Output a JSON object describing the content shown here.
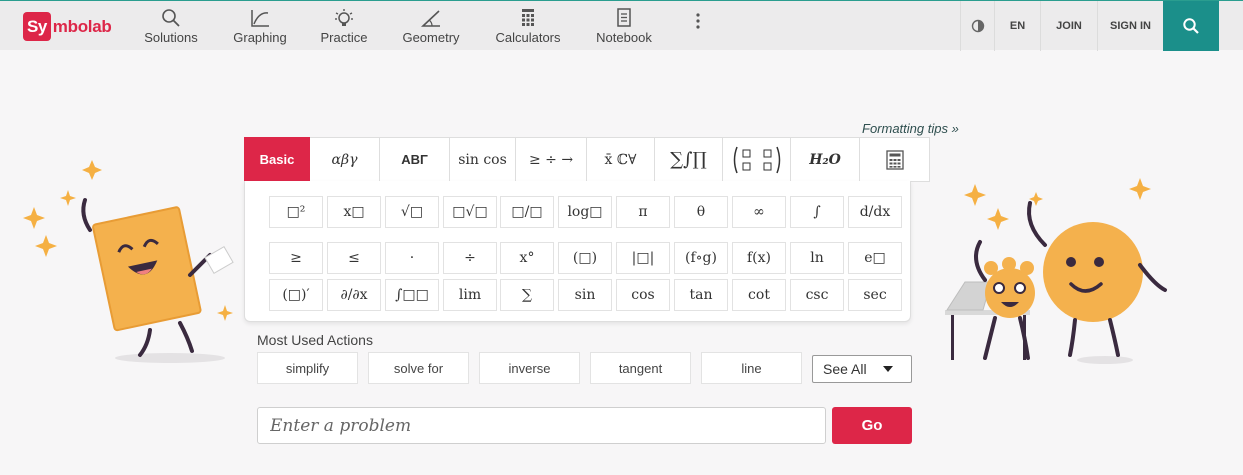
{
  "brand": {
    "logo_box": "Sy",
    "logo_rest": "mbolab",
    "accent": "#dd2648",
    "teal": "#1b8f8a"
  },
  "nav": [
    {
      "label": "Solutions",
      "icon": "search-icon"
    },
    {
      "label": "Graphing",
      "icon": "graph-icon"
    },
    {
      "label": "Practice",
      "icon": "lightbulb-icon"
    },
    {
      "label": "Geometry",
      "icon": "angle-icon"
    },
    {
      "label": "Calculators",
      "icon": "calculator-icon"
    },
    {
      "label": "Notebook",
      "icon": "notebook-icon"
    }
  ],
  "header_right": {
    "theme_icon": "contrast-icon",
    "language": "EN",
    "join": "JOIN",
    "sign_in": "SIGN IN",
    "search_icon": "search-icon"
  },
  "formatting_tips": "Formatting tips »",
  "tabs": [
    "Basic",
    "αβγ",
    "ABΓ",
    "sin cos",
    "≥ ÷ →",
    "x̄ ℂ∀",
    "∑∫∏",
    "matrix",
    "H₂O",
    "calculator"
  ],
  "keys": [
    [
      "□²",
      "x□",
      "√□",
      "□√□",
      "□/□",
      "log□",
      "π",
      "θ",
      "∞",
      "∫",
      "d/dx"
    ],
    [
      "≥",
      "≤",
      "·",
      "÷",
      "x°",
      "(□)",
      "|□|",
      "(f∘g)",
      "f(x)",
      "ln",
      "e□"
    ],
    [
      "(□)′",
      "∂/∂x",
      "∫□□",
      "lim",
      "∑",
      "sin",
      "cos",
      "tan",
      "cot",
      "csc",
      "sec"
    ]
  ],
  "most_used": {
    "label": "Most Used Actions",
    "actions": [
      "simplify",
      "solve for",
      "inverse",
      "tangent",
      "line"
    ],
    "see_all": "See All"
  },
  "problem": {
    "placeholder": "Enter a problem",
    "go": "Go"
  }
}
